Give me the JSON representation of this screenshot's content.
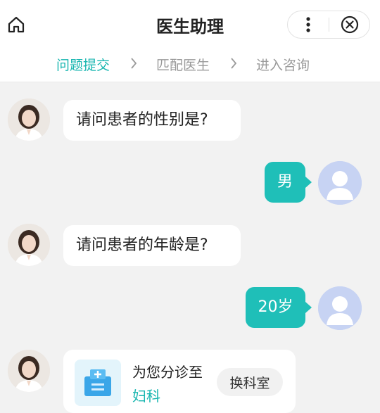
{
  "header": {
    "title": "医生助理",
    "icons": {
      "home": "home-icon",
      "more": "more-vertical-icon",
      "close": "close-circle-icon"
    }
  },
  "steps": [
    {
      "label": "问题提交",
      "state": "active"
    },
    {
      "label": "匹配医生",
      "state": "inactive"
    },
    {
      "label": "进入咨询",
      "state": "inactive"
    }
  ],
  "colors": {
    "accent": "#1fbfb8",
    "background": "#f2f2f2",
    "inactive_text": "#9a9a9a"
  },
  "messages": [
    {
      "from": "doctor",
      "text": "请问患者的性别是?"
    },
    {
      "from": "user",
      "text": "男"
    },
    {
      "from": "doctor",
      "text": "请问患者的年龄是?"
    },
    {
      "from": "user",
      "text": "20岁"
    }
  ],
  "department_card": {
    "prefix": "为您分诊至",
    "department": "妇科",
    "switch_label": "换科室",
    "icon": "hospital-icon"
  }
}
